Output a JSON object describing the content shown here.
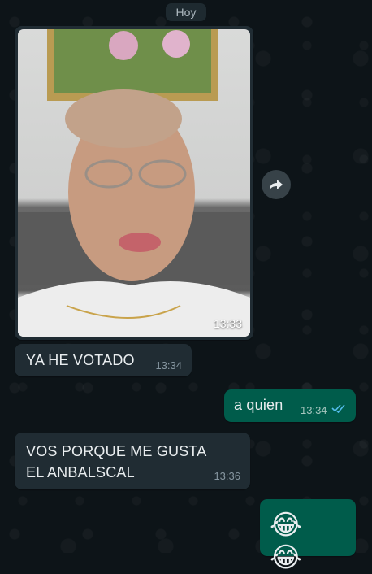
{
  "chat": {
    "date_chip": "Hoy",
    "messages": [
      {
        "direction": "incoming",
        "type": "photo",
        "time": "13:33"
      },
      {
        "direction": "incoming",
        "type": "text",
        "text": "YA HE VOTADO",
        "time": "13:34"
      },
      {
        "direction": "outgoing",
        "type": "text",
        "text": "a quien",
        "time": "13:34",
        "status": "read"
      },
      {
        "direction": "incoming",
        "type": "text",
        "text": "VOS PORQUE ME GUSTA EL ANBALSCAL",
        "time": "13:36"
      },
      {
        "direction": "outgoing",
        "type": "text",
        "text": "😂 😂"
      }
    ]
  },
  "icons": {
    "forward": "forward-icon",
    "read_receipt": "double-check-icon"
  },
  "colors": {
    "background": "#0d1418",
    "incoming_bubble": "#202c33",
    "outgoing_bubble": "#005c4b",
    "read_ticks": "#53bdeb"
  }
}
